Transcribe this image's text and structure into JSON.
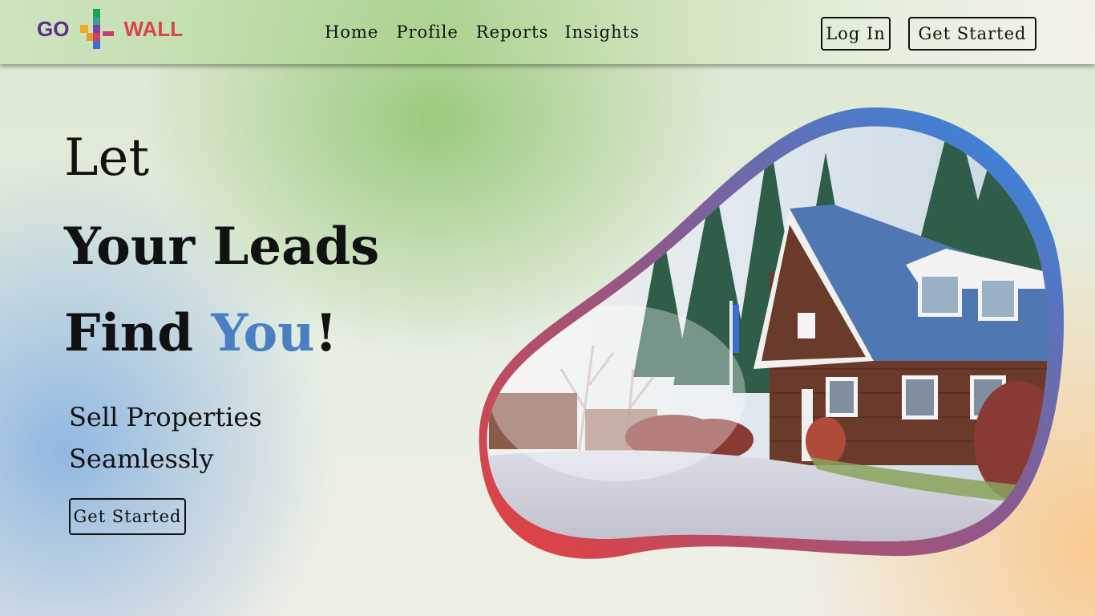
{
  "brand": {
    "left": "GO",
    "right": "WALL",
    "colors": {
      "go": "#5b2d8e",
      "wall": "#d9434a"
    }
  },
  "nav": {
    "links": [
      {
        "label": "Home"
      },
      {
        "label": "Profile"
      },
      {
        "label": "Reports"
      },
      {
        "label": "Insights"
      }
    ],
    "login_label": "Log In",
    "cta_label": "Get Started"
  },
  "hero": {
    "line1": "Let",
    "line2": "Your Leads",
    "line3_prefix": "Find ",
    "line3_accent": "You",
    "line3_suffix": "!",
    "accent_color": "#4a7fc4",
    "tagline_line1": "Sell Properties",
    "tagline_line2": "Seamlessly",
    "cta_label": "Get Started",
    "image": {
      "subject": "house-photo",
      "frame_gradient": [
        "#e8403d",
        "#8a5a8e",
        "#2d8be8"
      ]
    }
  }
}
